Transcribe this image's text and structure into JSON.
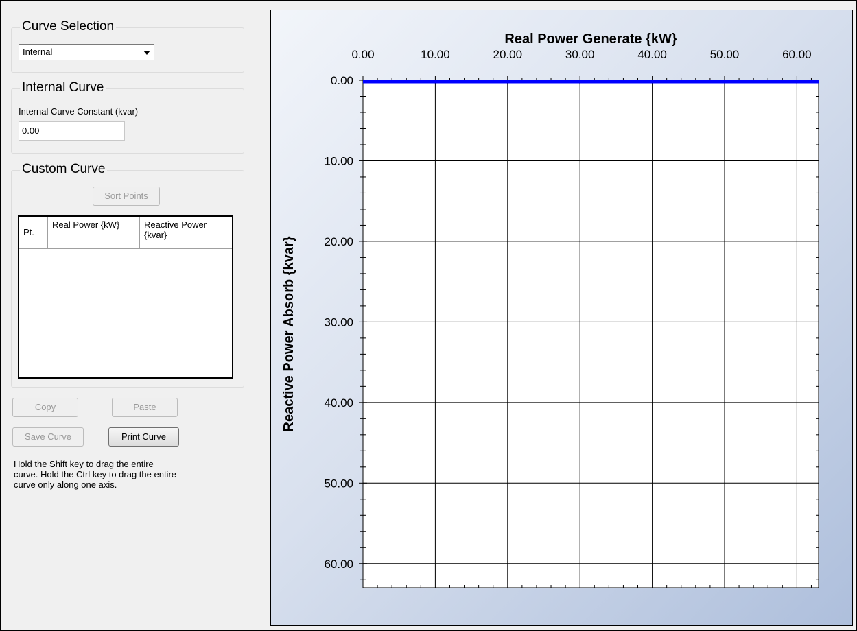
{
  "curve_selection": {
    "title": "Curve Selection",
    "selected": "Internal"
  },
  "internal_curve": {
    "title": "Internal Curve",
    "constant_label": "Internal Curve Constant (kvar)",
    "constant_value": "0.00"
  },
  "custom_curve": {
    "title": "Custom Curve",
    "sort_button": "Sort Points",
    "columns": [
      {
        "label": "Pt."
      },
      {
        "label": "Real Power {kW}"
      },
      {
        "label": "Reactive Power {kvar}"
      }
    ],
    "rows": []
  },
  "actions": {
    "copy": "Copy",
    "paste": "Paste",
    "save_curve": "Save Curve",
    "print_curve": "Print Curve"
  },
  "help_text": "Hold the Shift key to drag the entire curve.  Hold the Ctrl key to drag the entire curve only along one axis.",
  "colors": {
    "series": "#0000ff",
    "panel_gradient_start": "#f2f5fa",
    "panel_gradient_end": "#aebfdc"
  },
  "chart_data": {
    "type": "line",
    "title": "",
    "xlabel": "Real Power Generate {kW}",
    "ylabel": "Reactive Power Absorb {kvar}",
    "x_axis_position": "top",
    "y_axis_inverted": true,
    "xlim": [
      0,
      63
    ],
    "ylim": [
      0,
      63
    ],
    "x_ticks": [
      "0.00",
      "10.00",
      "20.00",
      "30.00",
      "40.00",
      "50.00",
      "60.00"
    ],
    "y_ticks": [
      "0.00",
      "10.00",
      "20.00",
      "30.00",
      "40.00",
      "50.00",
      "60.00"
    ],
    "grid": true,
    "series": [
      {
        "x": [
          0,
          63
        ],
        "y": [
          0,
          0
        ]
      }
    ]
  }
}
